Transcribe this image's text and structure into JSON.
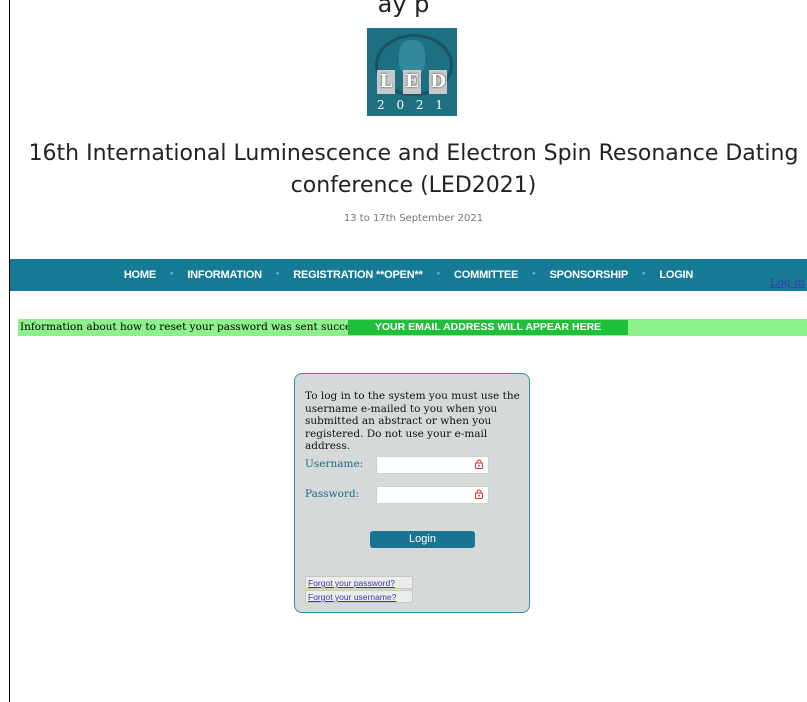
{
  "header": {
    "top_cut_text": "ay p",
    "logo": {
      "letters": [
        "L",
        "E",
        "D"
      ],
      "year": "2 0 2 1"
    },
    "title": "16th International Luminescence and Electron Spin Resonance Dating conference (LED2021)",
    "dates": "13 to 17th September 2021"
  },
  "nav": {
    "items": [
      "HOME",
      "INFORMATION",
      "REGISTRATION **OPEN**",
      "COMMITTEE",
      "SPONSORSHIP",
      "LOGIN"
    ],
    "separator": "•"
  },
  "login_link": "Log in",
  "info": {
    "message": "Information about how to reset your password was sent successfully to",
    "email_placeholder": "YOUR EMAIL ADDRESS WILL APPEAR HERE"
  },
  "login_panel": {
    "intro": "To log in to the system you must use the username e-mailed to you when you submitted an abstract or when you registered. Do not use your e-mail address.",
    "username_label": "Username:",
    "password_label": "Password:",
    "button_label": "Login",
    "forgot_password": "Forgot your password?",
    "forgot_username": "Forgot your username?"
  },
  "colors": {
    "nav_bg": "#157a94",
    "info_bg": "#8cf08c",
    "email_bg": "#1fbf3a",
    "panel_border": "#2f8fb3"
  },
  "icons": [
    "lock-icon"
  ]
}
